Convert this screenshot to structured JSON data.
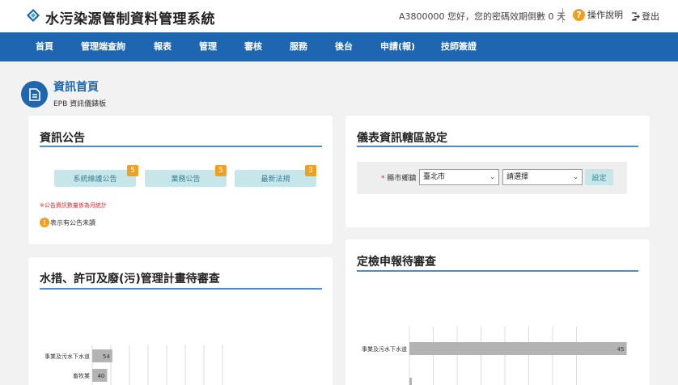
{
  "header": {
    "title": "水污染源管制資料管理系統",
    "user_info": "A3800000 您好，您的密碼效期倒數 0 天",
    "help_label": "操作說明",
    "logout_label": "登出"
  },
  "nav": {
    "items": [
      "首頁",
      "管理端查詢",
      "報表",
      "管理",
      "審核",
      "服務",
      "後台",
      "申請(報)",
      "技師簽證"
    ]
  },
  "page": {
    "title": "資訊首頁",
    "subtitle": "EPB 資訊儀錶板"
  },
  "announcements": {
    "title": "資訊公告",
    "buttons": [
      {
        "label": "系統維護公告",
        "count": "5"
      },
      {
        "label": "業務公告",
        "count": "5"
      },
      {
        "label": "最新法規",
        "count": "3"
      }
    ],
    "note": "※公告資訊數量係為月統計",
    "legend_badge": "1",
    "legend_text": "表示有公告未讀"
  },
  "dashboard_settings": {
    "title": "儀表資訊轄區設定",
    "field_required": "*",
    "field_label": "縣市鄉鎮",
    "city_value": "臺北市",
    "district_value": "請選擇",
    "set_button": "設定"
  },
  "permit_review": {
    "title": "水措、許可及廢(污)管理計畫待審查"
  },
  "inspection_review": {
    "title": "定檢申報待審查"
  },
  "chart_data": [
    {
      "type": "bar",
      "orientation": "horizontal",
      "title": "水措、許可及廢(污)管理計畫待審查",
      "categories": [
        "事業及污水下水道",
        "畜牧業"
      ],
      "values": [
        54,
        40
      ],
      "colors": {
        "bar": "#b3b3b3",
        "grid": "#dddddd"
      }
    },
    {
      "type": "bar",
      "orientation": "horizontal",
      "title": "定檢申報待審查",
      "categories": [
        "事業及污水下水道"
      ],
      "values": [
        45
      ],
      "colors": {
        "bar": "#b3b3b3",
        "grid": "#dddddd"
      }
    }
  ],
  "colors": {
    "brand": "#1f66b0",
    "accent": "#f0a01e",
    "button_bg": "#c7e6ea",
    "warning_text": "#d42a2a"
  }
}
